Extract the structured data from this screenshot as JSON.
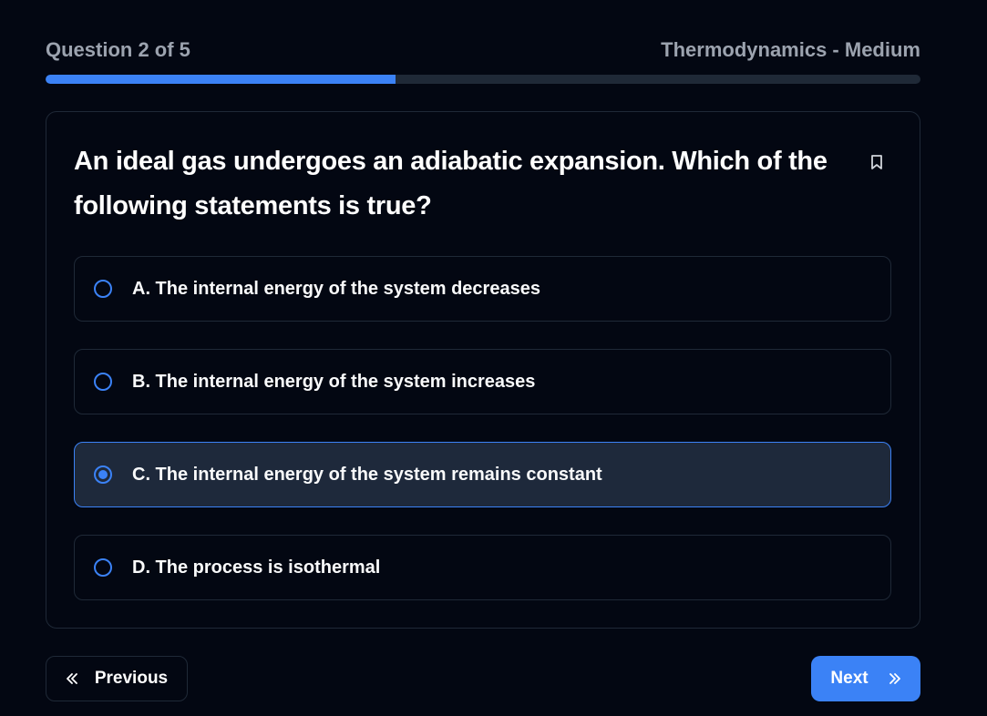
{
  "header": {
    "progress_text": "Question 2 of 5",
    "category_text": "Thermodynamics - Medium"
  },
  "progress": {
    "current": 2,
    "total": 5,
    "fraction": 0.4
  },
  "question": {
    "text": "An ideal gas undergoes an adiabatic expansion. Which of the following statements is true?",
    "bookmark_icon": "bookmark-icon"
  },
  "options": [
    {
      "label": "A. The internal energy of the system decreases",
      "selected": false
    },
    {
      "label": "B. The internal energy of the system increases",
      "selected": false
    },
    {
      "label": "C. The internal energy of the system remains constant",
      "selected": true
    },
    {
      "label": "D. The process is isothermal",
      "selected": false
    }
  ],
  "nav": {
    "previous_label": "Previous",
    "next_label": "Next",
    "previous_icon": "chevrons-left-icon",
    "next_icon": "chevrons-right-icon"
  },
  "colors": {
    "background": "#030712",
    "accent": "#3b82f6",
    "muted_text": "#9ca3af",
    "border": "#1f2937",
    "selected_bg": "#1e293b"
  }
}
